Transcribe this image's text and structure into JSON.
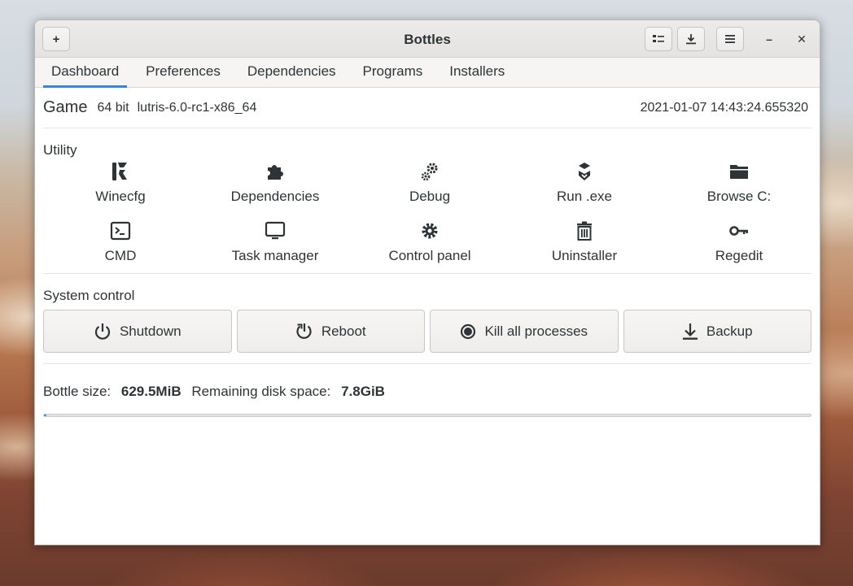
{
  "window": {
    "title": "Bottles"
  },
  "headerbar": {
    "new_label": "+",
    "close_label": "✕",
    "minimize_label": "–"
  },
  "tabs": [
    {
      "label": "Dashboard",
      "active": true
    },
    {
      "label": "Preferences",
      "active": false
    },
    {
      "label": "Dependencies",
      "active": false
    },
    {
      "label": "Programs",
      "active": false
    },
    {
      "label": "Installers",
      "active": false
    }
  ],
  "bottle": {
    "name": "Game",
    "arch": "64 bit",
    "runner": "lutris-6.0-rc1-x86_64",
    "date": "2021-01-07 14:43:24.655320"
  },
  "utility": {
    "title": "Utility",
    "items": [
      {
        "label": "Winecfg",
        "icon": "winecfg-icon"
      },
      {
        "label": "Dependencies",
        "icon": "puzzle-icon"
      },
      {
        "label": "Debug",
        "icon": "gears-icon"
      },
      {
        "label": "Run .exe",
        "icon": "run-exe-icon"
      },
      {
        "label": "Browse C:",
        "icon": "folder-icon"
      },
      {
        "label": "CMD",
        "icon": "terminal-icon"
      },
      {
        "label": "Task manager",
        "icon": "monitor-icon"
      },
      {
        "label": "Control panel",
        "icon": "gear-icon"
      },
      {
        "label": "Uninstaller",
        "icon": "trash-icon"
      },
      {
        "label": "Regedit",
        "icon": "key-icon"
      }
    ]
  },
  "system_control": {
    "title": "System control",
    "buttons": [
      {
        "label": "Shutdown",
        "icon": "power-icon"
      },
      {
        "label": "Reboot",
        "icon": "reboot-icon"
      },
      {
        "label": "Kill all processes",
        "icon": "stop-icon"
      },
      {
        "label": "Backup",
        "icon": "download-icon"
      }
    ]
  },
  "disk": {
    "bottle_size_label": "Bottle size:",
    "bottle_size_value": "629.5MiB",
    "remaining_label": "Remaining disk space:",
    "remaining_value": "7.8GiB",
    "usage_fraction": 0.003
  },
  "colors": {
    "accent": "#3584e4"
  }
}
